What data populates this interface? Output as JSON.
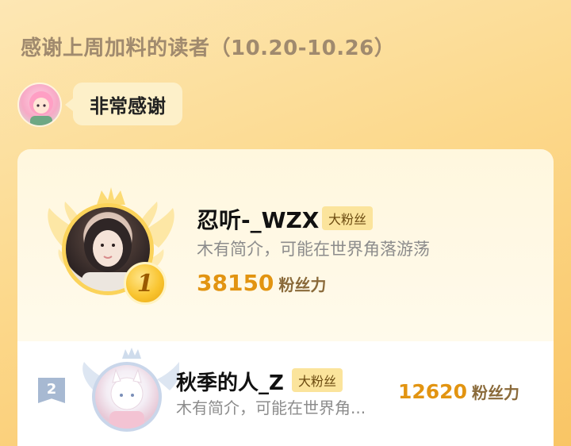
{
  "header": {
    "title": "感谢上周加料的读者（10.20-10.26）",
    "thanks_message": "非常感谢"
  },
  "leaderboard": [
    {
      "rank": "1",
      "name": "忍听-_WZX",
      "badge": "大粉丝",
      "bio": "木有简介，可能在世界角落游荡",
      "fans_value": "38150",
      "fans_label": "粉丝力"
    },
    {
      "rank": "2",
      "name": "秋季的人_Z",
      "badge": "大粉丝",
      "bio": "木有简介，可能在世界角...",
      "fans_value": "12620",
      "fans_label": "粉丝力"
    }
  ],
  "colors": {
    "accent": "#e29411",
    "gold_medal": "#f9c531",
    "silver_flag": "#a7b9d2",
    "badge_bg": "#fbe49c"
  },
  "icons": {
    "rank1": "gold-crown-wings-icon",
    "rank2": "silver-rank-flag-icon"
  }
}
